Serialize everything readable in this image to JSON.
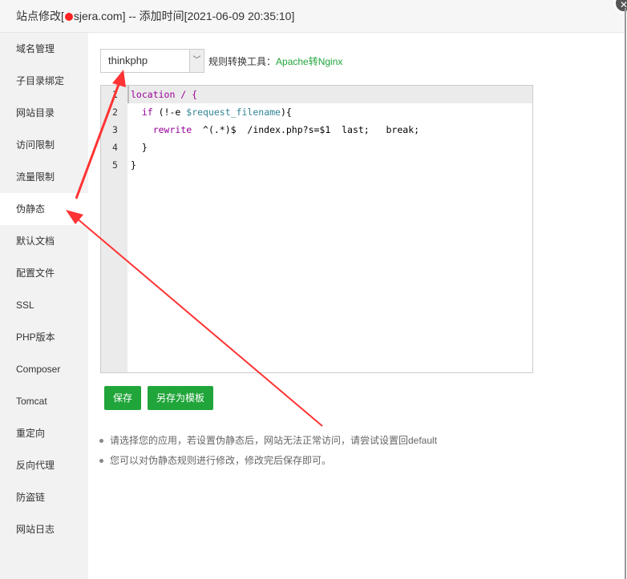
{
  "title": {
    "prefix": "站点修改[",
    "suffix": "sjera.com] -- 添加时间[2021-06-09 20:35:10]"
  },
  "close_icon": "close-icon",
  "sidebar": {
    "active": 5,
    "items": [
      "域名管理",
      "子目录绑定",
      "网站目录",
      "访问限制",
      "流量限制",
      "伪静态",
      "默认文档",
      "配置文件",
      "SSL",
      "PHP版本",
      "Composer",
      "Tomcat",
      "重定向",
      "反向代理",
      "防盗链",
      "网站日志"
    ]
  },
  "main": {
    "select_value": "thinkphp",
    "tool_label": "规则转换工具：",
    "tool_link": "Apache转Nginx",
    "line_numbers": [
      "1",
      "2",
      "3",
      "4",
      "5"
    ],
    "save_label": "保存",
    "save_template_label": "另存为模板",
    "tips": [
      "请选择您的应用，若设置伪静态后，网站无法正常访问，请尝试设置回default",
      "您可以对伪静态规则进行修改，修改完后保存即可。"
    ]
  },
  "code": {
    "l1": "location / {",
    "l2a": "  ",
    "l2kw": "if",
    "l2b": " (!-e ",
    "l2var": "$request_filename",
    "l2c": "){",
    "l3a": "    ",
    "l3kw": "rewrite",
    "l3b": "  ^(.*)$  /index.php?s=$1  last;   break;",
    "l4": "  }",
    "l5": "}"
  },
  "colors": {
    "accent": "#20a53a",
    "annotation": "#f33"
  }
}
